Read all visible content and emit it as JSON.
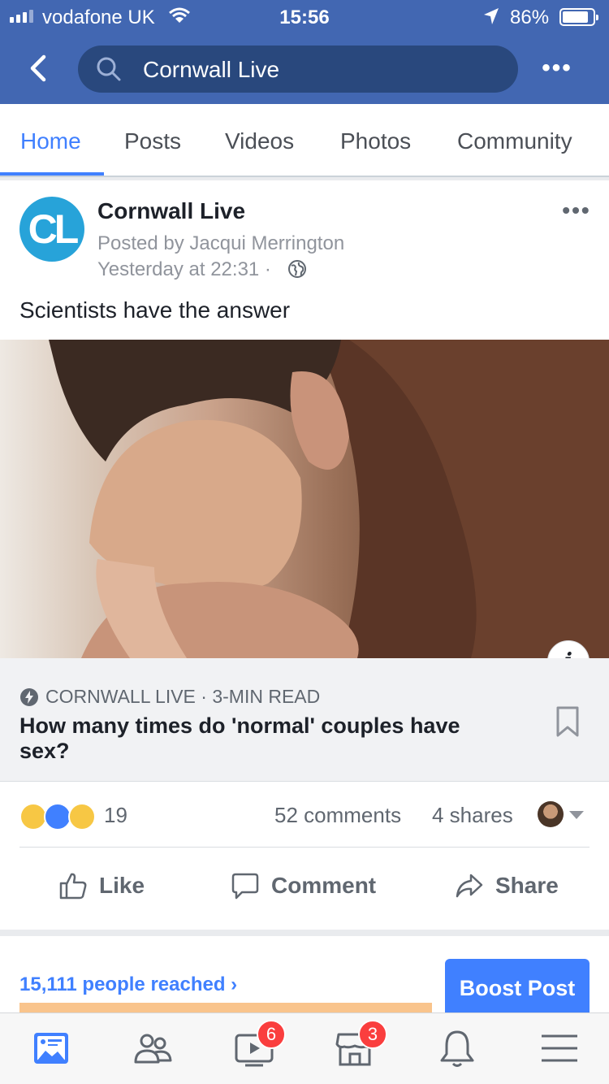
{
  "status_bar": {
    "carrier": "vodafone UK",
    "time": "15:56",
    "battery_percent": "86%",
    "battery_level": 0.86
  },
  "nav": {
    "search_text": "Cornwall Live"
  },
  "tabs": [
    {
      "label": "Home",
      "active": true
    },
    {
      "label": "Posts",
      "active": false
    },
    {
      "label": "Videos",
      "active": false
    },
    {
      "label": "Photos",
      "active": false
    },
    {
      "label": "Community",
      "active": false
    }
  ],
  "post": {
    "avatar_text": "CL",
    "page_name": "Cornwall Live",
    "posted_by": "Posted by Jacqui Merrington",
    "time": "Yesterday at 22:31 ·",
    "text": "Scientists have the answer",
    "link": {
      "source": "CORNWALL LIVE · 3-MIN READ",
      "title": "How many times do 'normal' couples have sex?"
    },
    "reactions": {
      "types": [
        "haha-icon",
        "like-icon",
        "sad-icon"
      ],
      "count": "19",
      "comments": "52 comments",
      "shares": "4 shares"
    },
    "actions": {
      "like": "Like",
      "comment": "Comment",
      "share": "Share"
    }
  },
  "promo": {
    "reach": "15,111 people reached",
    "boost_label": "Boost Post"
  },
  "bottom_nav": {
    "video_badge": "6",
    "marketplace_badge": "3"
  },
  "colors": {
    "brand": "#4267b2",
    "accent": "#4080ff",
    "badge": "#fa3e3e"
  }
}
